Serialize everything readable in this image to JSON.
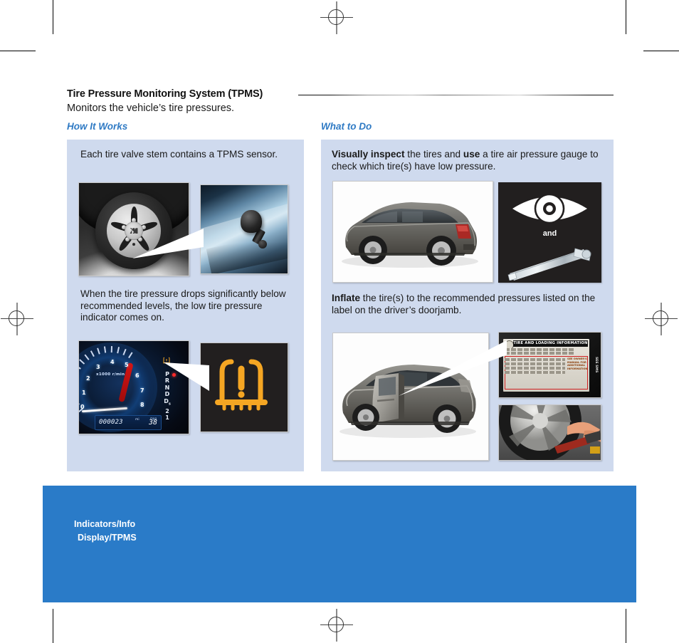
{
  "page": {
    "title": "Tire Pressure Monitoring System (TPMS)",
    "subtitle": "Monitors the vehicle’s tire pressures."
  },
  "columns": {
    "left_heading": "How It Works",
    "right_heading": "What to Do"
  },
  "how_it_works": {
    "step1_text": "Each tire valve stem contains a TPMS sensor.",
    "step2_text": "When the tire pressure drops significantly below recommended levels, the low tire pressure indicator comes on.",
    "images": {
      "wheel_alt": "front wheel with alloy rim and tire",
      "valve_stem_alt": "close-up of black tire valve stem on blue wheel",
      "cluster_alt": "instrument cluster tachometer with low tire pressure indicator lit",
      "tpms_icon_alt": "amber low tire pressure TPMS warning symbol"
    },
    "cluster": {
      "tach_numbers": [
        "0",
        "1",
        "2",
        "3",
        "4",
        "5",
        "6",
        "7",
        "8"
      ],
      "tach_label": "x1000 r/min",
      "odometer": "000023",
      "odometer_unit": "mi",
      "fuel_economy": "38",
      "fuel_economy_unit": "mpg",
      "gear_positions": "PRND21"
    }
  },
  "what_to_do": {
    "step1_prefix_bold": "Visually inspect",
    "step1_mid": " the tires and ",
    "step1_bold2": "use",
    "step1_suffix": " a tire air pressure gauge to check which tire(s) have low pressure.",
    "step2_bold": "Inflate",
    "step2_suffix": " the tire(s) to the recommended pressures listed on the label on the driver’s doorjamb.",
    "and_label": "and",
    "images": {
      "sedan_alt": "silver sedan rear three-quarter view",
      "eye_gauge_alt": "eye symbol and pencil-style tire pressure gauge",
      "door_open_alt": "sedan with driver door open",
      "doorjamb_label_alt": "tire and loading information label on doorjamb",
      "inflate_alt": "hand inflating tire with air hose"
    },
    "doorjamb_label": {
      "heading": "TIRE AND LOADING INFORMATION",
      "note": "SEE OWNER'S MANUAL FOR ADDITIONAL INFORMATION",
      "side_code": "SEE SMS"
    }
  },
  "footer": {
    "line1": "Indicators/Info",
    "line2": "Display/TPMS"
  },
  "colors": {
    "accent_blue": "#2f7ac4",
    "panel_blue": "#cfdaee",
    "banner_blue": "#2a7bc8",
    "warning_amber": "#f5a623",
    "page_background": "#ffffff"
  }
}
